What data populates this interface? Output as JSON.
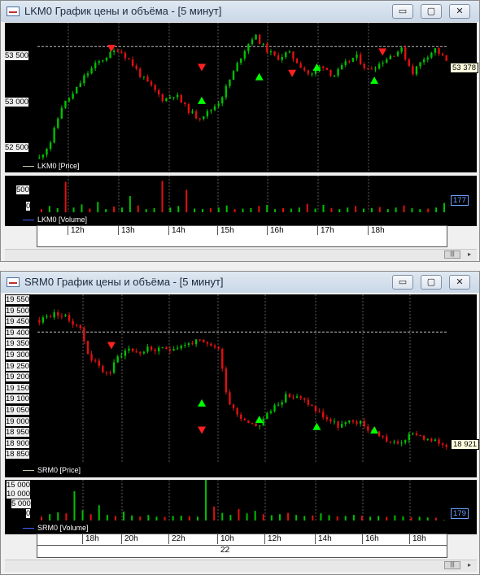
{
  "windows": [
    {
      "title": "LKM0 График цены и объёма - [5 минут]",
      "buttons": {
        "minimize": "▭",
        "maximize": "▢",
        "close": "✕"
      },
      "price_pane": {
        "legend": "LKM0 [Price]",
        "y_labels_left": [
          "53 500",
          "53 000",
          "52 500"
        ],
        "y_labels_right": [
          "53 500",
          "53 000",
          "52 500"
        ],
        "last_value": "53 378",
        "ref_line": "53 500"
      },
      "volume_pane": {
        "legend": "LKM0 [Volume]",
        "y_labels_left": [
          "500",
          "0"
        ],
        "y_labels_right": [
          "500",
          "0"
        ],
        "last_value": "177"
      },
      "time_labels": [
        "12h",
        "13h",
        "14h",
        "15h",
        "16h",
        "17h",
        "18h"
      ],
      "date_labels": [],
      "scroll_thumb": "|||",
      "colors": {
        "up": "#00c000",
        "down": "#e01010",
        "buy_marker": "#00ff00",
        "sell_marker": "#ff2020",
        "legend_line_price": "#c8c8a0",
        "legend_line_volume": "#4060ff"
      }
    },
    {
      "title": "SRM0 График цены и объёма - [5 минут]",
      "buttons": {
        "minimize": "▭",
        "maximize": "▢",
        "close": "✕"
      },
      "price_pane": {
        "legend": "SRM0 [Price]",
        "y_labels_left": [
          "19 550",
          "19 500",
          "19 450",
          "19 400",
          "19 350",
          "19 300",
          "19 250",
          "19 200",
          "19 150",
          "19 100",
          "19 050",
          "19 000",
          "18 950",
          "18 900",
          "18 850"
        ],
        "y_labels_right": [
          "19 550",
          "19 500",
          "19 450",
          "19 400",
          "19 350",
          "19 300",
          "19 250",
          "19 200",
          "19 150",
          "19 100",
          "19 050",
          "19 000",
          "18 950",
          "18 921",
          "18 850"
        ],
        "last_value": "18 921",
        "ref_line": "19 400"
      },
      "volume_pane": {
        "legend": "SRM0 [Volume]",
        "y_labels_left": [
          "15 000",
          "10 000",
          "5 000",
          "0"
        ],
        "y_labels_right": [
          "15 000",
          "10 000",
          "5 000",
          "0"
        ],
        "last_value": "179"
      },
      "time_labels": [
        "18h",
        "20h",
        "22h",
        "10h",
        "12h",
        "14h",
        "16h",
        "18h"
      ],
      "date_labels": [
        "22"
      ],
      "scroll_thumb": "|||",
      "colors": {
        "up": "#00c000",
        "down": "#e01010",
        "buy_marker": "#00ff00",
        "sell_marker": "#ff2020",
        "legend_line_price": "#c8c8a0",
        "legend_line_volume": "#4060ff"
      }
    }
  ],
  "chart_data": [
    {
      "type": "candlestick",
      "title": "LKM0 [Price]",
      "xlabel": "",
      "ylabel": "",
      "ylim": [
        52440,
        53700
      ],
      "x_ticks": [
        "12h",
        "13h",
        "14h",
        "15h",
        "16h",
        "17h",
        "18h"
      ],
      "close_trace": [
        52560,
        52700,
        53000,
        53100,
        53250,
        53350,
        53420,
        53480,
        53380,
        53250,
        53150,
        53050,
        53100,
        52980,
        52900,
        52950,
        53050,
        53250,
        53450,
        53600,
        53480,
        53400,
        53450,
        53350,
        53250,
        53350,
        53250,
        53350,
        53420,
        53300,
        53350,
        53420,
        53480,
        53280,
        53400,
        53480,
        53378
      ],
      "last": 53378,
      "reference_level": 53500,
      "buy_markers_at": [
        53050,
        53250,
        53330,
        53220
      ],
      "sell_markers_at": [
        53480,
        53320,
        53270,
        53450
      ],
      "grid": true
    },
    {
      "type": "bar",
      "title": "LKM0 [Volume]",
      "ylim": [
        0,
        700
      ],
      "values": [
        60,
        120,
        80,
        580,
        90,
        150,
        70,
        200,
        60,
        110,
        90,
        310,
        130,
        60,
        80,
        600,
        90,
        120,
        430,
        70,
        60,
        80,
        90,
        130,
        60,
        70,
        80,
        120,
        140,
        60,
        80,
        70,
        90,
        160,
        70,
        140,
        80,
        60,
        90,
        120,
        70,
        80,
        100,
        60,
        90,
        130,
        80,
        60,
        70,
        90,
        177
      ],
      "last": 177,
      "grid": true
    },
    {
      "type": "candlestick",
      "title": "SRM0 [Price]",
      "xlabel": "",
      "ylabel": "",
      "ylim": [
        18840,
        19560
      ],
      "x_ticks": [
        "18h",
        "20h",
        "22h",
        "10h",
        "12h",
        "14h",
        "16h",
        "18h"
      ],
      "close_trace": [
        19450,
        19470,
        19480,
        19450,
        19430,
        19300,
        19250,
        19220,
        19300,
        19330,
        19310,
        19330,
        19320,
        19330,
        19340,
        19350,
        19360,
        19340,
        19340,
        19110,
        19050,
        19020,
        19000,
        19050,
        19100,
        19130,
        19120,
        19100,
        19060,
        19030,
        19000,
        19010,
        19020,
        18990,
        18970,
        18940,
        18920,
        18950,
        18970,
        18940,
        18930,
        18921
      ],
      "last": 18921,
      "reference_level": 19400,
      "buy_markers_at": [
        19100,
        19030,
        19000,
        18985
      ],
      "sell_markers_at": [
        19340,
        18980
      ],
      "grid": true
    },
    {
      "type": "bar",
      "title": "SRM0 [Volume]",
      "ylim": [
        0,
        16000
      ],
      "values": [
        1500,
        2500,
        3200,
        2800,
        11500,
        4000,
        2500,
        6000,
        2200,
        1800,
        3500,
        2000,
        1600,
        2200,
        1500,
        1400,
        1800,
        1900,
        1700,
        1500,
        16000,
        5500,
        3000,
        2200,
        4500,
        2800,
        3800,
        2500,
        2100,
        2500,
        3000,
        2200,
        1800,
        2000,
        2800,
        2100,
        1600,
        1800,
        2200,
        1900,
        1500,
        1800,
        1400,
        2000,
        1600,
        1300,
        1500,
        1200,
        1100,
        179
      ],
      "last": 179,
      "grid": true
    }
  ]
}
